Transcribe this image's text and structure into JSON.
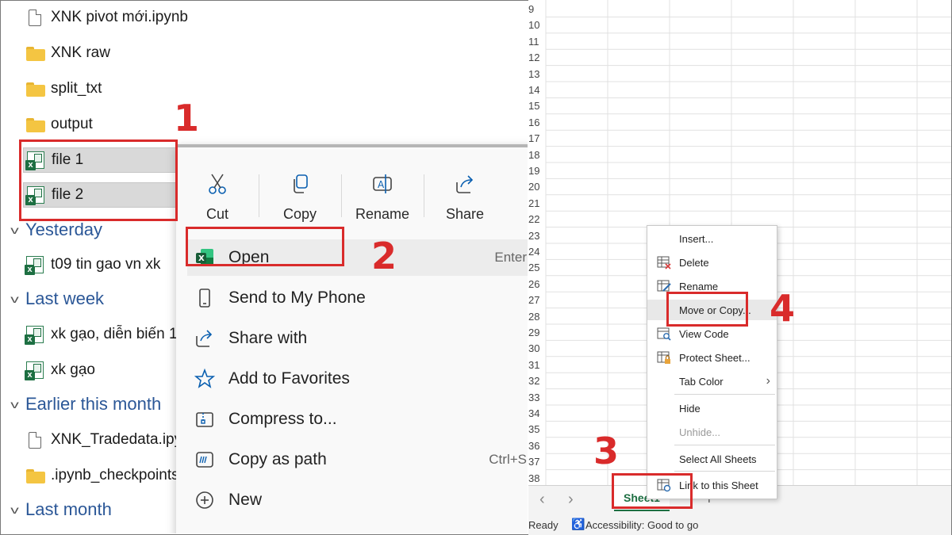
{
  "explorer": {
    "top_items": [
      {
        "name": "XNK pivot mới.ipynb",
        "icon": "notebook-file-icon"
      },
      {
        "name": "XNK raw",
        "icon": "folder-icon"
      },
      {
        "name": "split_txt",
        "icon": "folder-icon"
      },
      {
        "name": "output",
        "icon": "folder-icon"
      }
    ],
    "selected_items": [
      {
        "name": "file 1",
        "icon": "excel-file-icon"
      },
      {
        "name": "file 2",
        "icon": "excel-file-icon"
      }
    ],
    "groups": [
      {
        "label": "Yesterday",
        "items": [
          {
            "name": "t09 tin gao vn xk",
            "icon": "excel-file-icon"
          }
        ]
      },
      {
        "label": "Last week",
        "items": [
          {
            "name": "xk gạo, diễn biến 1",
            "icon": "excel-file-icon"
          },
          {
            "name": "xk gạo",
            "icon": "excel-file-icon"
          }
        ]
      },
      {
        "label": "Earlier this month",
        "items": [
          {
            "name": "XNK_Tradedata.ipy",
            "icon": "notebook-file-icon"
          },
          {
            "name": ".ipynb_checkpoints",
            "icon": "folder-icon"
          }
        ]
      },
      {
        "label": "Last month",
        "items": []
      }
    ]
  },
  "context_menu": {
    "toolbar": [
      {
        "label": "Cut",
        "icon": "scissors-icon"
      },
      {
        "label": "Copy",
        "icon": "copy-icon"
      },
      {
        "label": "Rename",
        "icon": "rename-icon"
      },
      {
        "label": "Share",
        "icon": "share-icon"
      }
    ],
    "items": [
      {
        "label": "Open",
        "shortcut": "Enter",
        "icon": "excel-app-icon"
      },
      {
        "label": "Send to My Phone",
        "shortcut": "",
        "icon": "phone-icon"
      },
      {
        "label": "Share with",
        "shortcut": "",
        "icon": "share-with-icon"
      },
      {
        "label": "Add to Favorites",
        "shortcut": "",
        "icon": "star-icon"
      },
      {
        "label": "Compress to...",
        "shortcut": "",
        "icon": "zip-icon"
      },
      {
        "label": "Copy as path",
        "shortcut": "Ctrl+S",
        "icon": "path-icon"
      },
      {
        "label": "New",
        "shortcut": "",
        "icon": "plus-circle-icon"
      }
    ]
  },
  "excel": {
    "row_numbers": [
      "9",
      "10",
      "11",
      "12",
      "13",
      "14",
      "15",
      "16",
      "17",
      "18",
      "19",
      "20",
      "21",
      "22",
      "23",
      "24",
      "25",
      "26",
      "27",
      "28",
      "29",
      "30",
      "31",
      "32",
      "33",
      "34",
      "35",
      "36",
      "37",
      "38"
    ],
    "sheet_tab": "Sheet1",
    "add_sheet": "+",
    "nav_prev": "‹",
    "nav_next": "›",
    "status_ready": "Ready",
    "status_accessibility": "Accessibility: Good to go",
    "tab_menu": [
      {
        "label": "Insert...",
        "icon": "",
        "disabled": false
      },
      {
        "label": "Delete",
        "icon": "delete-sheet-icon",
        "disabled": false
      },
      {
        "label": "Rename",
        "icon": "rename-sheet-icon",
        "disabled": false
      },
      {
        "label": "Move or Copy...",
        "icon": "",
        "disabled": false
      },
      {
        "label": "View Code",
        "icon": "view-code-icon",
        "disabled": false
      },
      {
        "label": "Protect Sheet...",
        "icon": "protect-sheet-icon",
        "disabled": false
      },
      {
        "label": "Tab Color",
        "icon": "",
        "disabled": false,
        "submenu": "›"
      },
      {
        "label": "Hide",
        "icon": "",
        "disabled": false
      },
      {
        "label": "Unhide...",
        "icon": "",
        "disabled": true
      },
      {
        "label": "Select All Sheets",
        "icon": "",
        "disabled": false
      },
      {
        "label": "Link to this Sheet",
        "icon": "link-sheet-icon",
        "disabled": false
      }
    ]
  },
  "annotations": {
    "step1": "1",
    "step2": "2",
    "step3": "3",
    "step4": "4",
    "color": "#d92b2b"
  }
}
